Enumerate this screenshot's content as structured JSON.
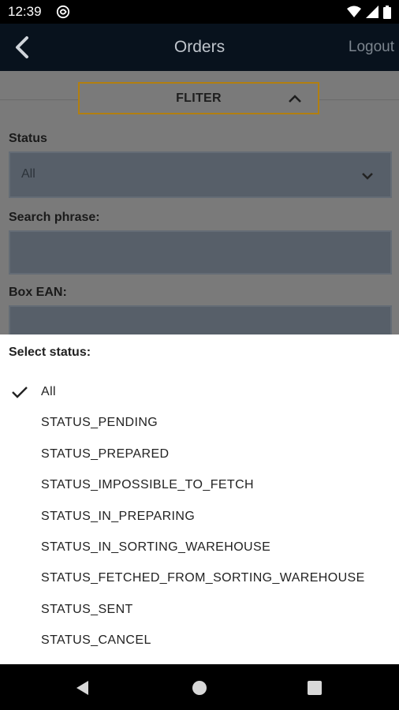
{
  "status_bar": {
    "time": "12:39"
  },
  "app_bar": {
    "title": "Orders",
    "logout": "Logout"
  },
  "filter": {
    "toggle_label": "FLITER",
    "status_label": "Status",
    "status_value": "All",
    "search_label": "Search phrase:",
    "search_value": "",
    "box_ean_label": "Box EAN:",
    "box_ean_value": ""
  },
  "sheet": {
    "heading": "Select status:",
    "selected": "All",
    "options": [
      "All",
      "STATUS_PENDING",
      "STATUS_PREPARED",
      "STATUS_IMPOSSIBLE_TO_FETCH",
      "STATUS_IN_PREPARING",
      "STATUS_IN_SORTING_WAREHOUSE",
      "STATUS_FETCHED_FROM_SORTING_WAREHOUSE",
      "STATUS_SENT",
      "STATUS_CANCEL"
    ]
  },
  "colors": {
    "app_bar": "#08121d",
    "accent_border": "#b27f10",
    "scrim": "#7a7a7a"
  }
}
